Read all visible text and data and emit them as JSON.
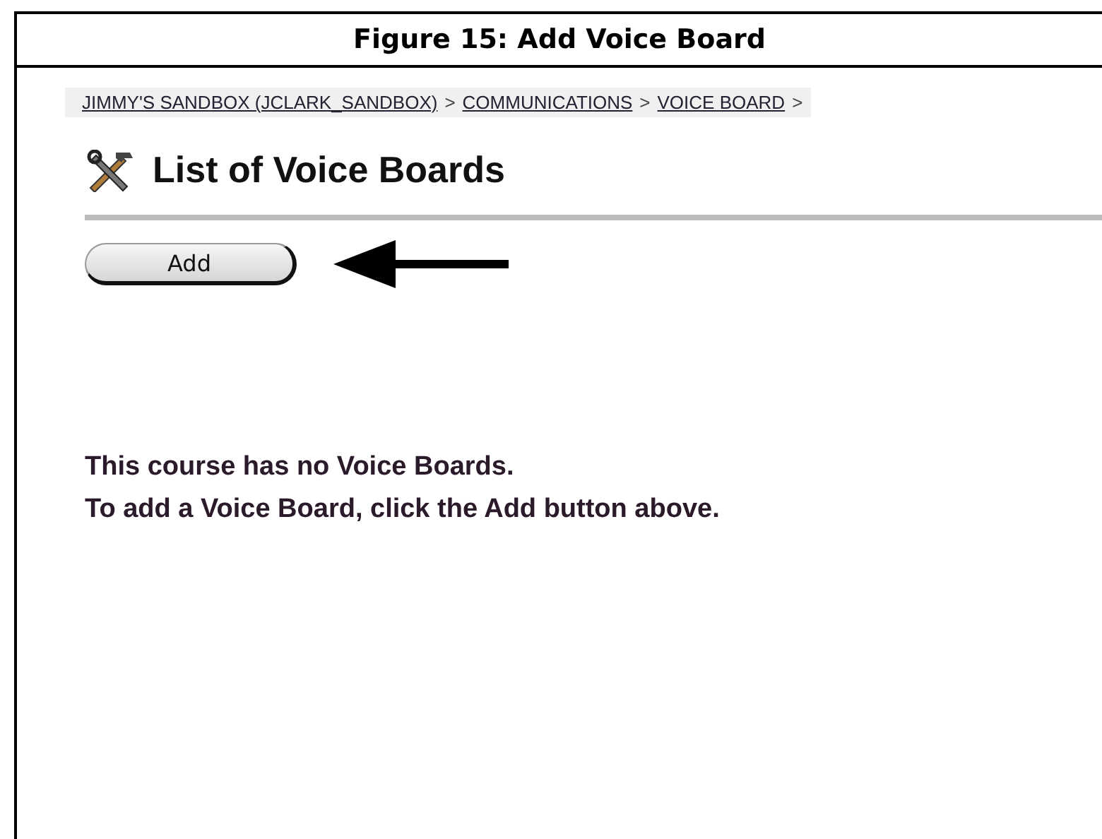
{
  "caption": "Figure 15: Add Voice Board",
  "breadcrumb": [
    {
      "kind": "link",
      "text": "JIMMY'S SANDBOX (JCLARK_SANDBOX)"
    },
    {
      "kind": "separator",
      "text": ">"
    },
    {
      "kind": "link",
      "text": "COMMUNICATIONS"
    },
    {
      "kind": "separator",
      "text": ">"
    },
    {
      "kind": "link",
      "text": "VOICE BOARD"
    },
    {
      "kind": "separator",
      "text": ">"
    }
  ],
  "page_title": "List of Voice Boards",
  "add_button": "Add",
  "message_lines": [
    "This course has no Voice Boards.",
    "To add a Voice Board, click the Add button above."
  ]
}
